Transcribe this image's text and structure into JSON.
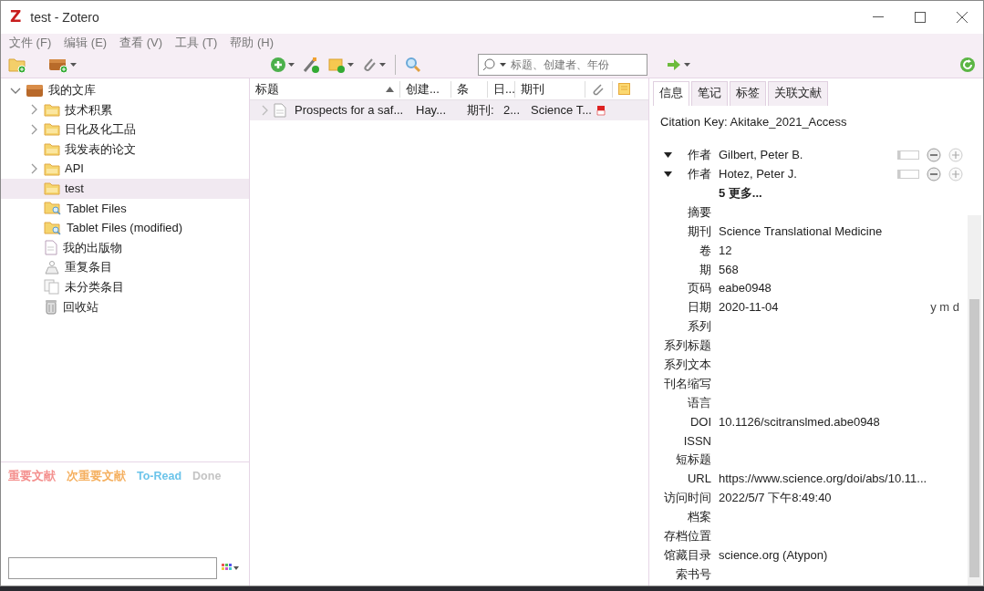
{
  "window": {
    "logo_letter": "Z",
    "title": "test - Zotero"
  },
  "menu": [
    "文件 (F)",
    "编辑 (E)",
    "查看 (V)",
    "工具 (T)",
    "帮助 (H)"
  ],
  "search": {
    "placeholder": "标题、创建者、年份"
  },
  "collections": [
    {
      "label": "我的文库",
      "kind": "library",
      "expanded": true,
      "selected": false,
      "children": [
        {
          "label": "技术积累",
          "kind": "folder",
          "expanded": false,
          "selected": false
        },
        {
          "label": "日化及化工品",
          "kind": "folder",
          "expanded": false,
          "selected": false
        },
        {
          "label": "我发表的论文",
          "kind": "folder",
          "selected": false
        },
        {
          "label": "API",
          "kind": "folder",
          "expanded": false,
          "selected": false
        },
        {
          "label": "test",
          "kind": "folder",
          "selected": true
        },
        {
          "label": "Tablet Files",
          "kind": "saved-search",
          "selected": false
        },
        {
          "label": "Tablet Files (modified)",
          "kind": "saved-search",
          "selected": false
        },
        {
          "label": "我的出版物",
          "kind": "publications",
          "selected": false
        },
        {
          "label": "重复条目",
          "kind": "duplicates",
          "selected": false
        },
        {
          "label": "未分类条目",
          "kind": "unfiled",
          "selected": false
        },
        {
          "label": "回收站",
          "kind": "trash",
          "selected": false
        }
      ]
    }
  ],
  "tags": [
    {
      "label": "重要文献",
      "color": "#f4908e"
    },
    {
      "label": "次重要文献",
      "color": "#f5b060"
    },
    {
      "label": "To-Read",
      "color": "#6cc4ea"
    },
    {
      "label": "Done",
      "color": "#c4c4c4"
    }
  ],
  "table": {
    "columns": [
      {
        "label": "标题",
        "sorted": true
      },
      {
        "label": "创建..."
      },
      {
        "label": "条"
      },
      {
        "label": "日..."
      },
      {
        "label": "期刊"
      }
    ],
    "rows": [
      {
        "selected": true,
        "cells": [
          "Prospects for a saf...",
          "Hay...",
          "期刊:",
          "2...",
          "Science T..."
        ],
        "has_pdf": true
      }
    ]
  },
  "item_pane": {
    "tabs": [
      {
        "label": "信息",
        "selected": true
      },
      {
        "label": "笔记",
        "selected": false
      },
      {
        "label": "标签",
        "selected": false
      },
      {
        "label": "关联文献",
        "selected": false
      }
    ],
    "citation_key": "Citation Key: Akitake_2021_Access",
    "fields": [
      {
        "kind": "creator",
        "label": "作者",
        "value": "Gilbert, Peter B."
      },
      {
        "kind": "creator",
        "label": "作者",
        "value": "Hotez, Peter J."
      },
      {
        "kind": "more",
        "value": "5 更多..."
      },
      {
        "kind": "field",
        "label": "摘要"
      },
      {
        "kind": "field",
        "label": "期刊",
        "value": "Science Translational Medicine"
      },
      {
        "kind": "field",
        "label": "卷",
        "value": "12"
      },
      {
        "kind": "field",
        "label": "期",
        "value": "568"
      },
      {
        "kind": "field",
        "label": "页码",
        "value": "eabe0948"
      },
      {
        "kind": "field",
        "label": "日期",
        "value": "2020-11-04",
        "hint": "y m d"
      },
      {
        "kind": "field",
        "label": "系列"
      },
      {
        "kind": "field",
        "label": "系列标题"
      },
      {
        "kind": "field",
        "label": "系列文本"
      },
      {
        "kind": "field",
        "label": "刊名缩写"
      },
      {
        "kind": "field",
        "label": "语言"
      },
      {
        "kind": "field",
        "label": "DOI",
        "value": "10.1126/scitranslmed.abe0948"
      },
      {
        "kind": "field",
        "label": "ISSN"
      },
      {
        "kind": "field",
        "label": "短标题"
      },
      {
        "kind": "field",
        "label": "URL",
        "value": "https://www.science.org/doi/abs/10.11..."
      },
      {
        "kind": "field",
        "label": "访问时间",
        "value": "2022/5/7 下午8:49:40"
      },
      {
        "kind": "field",
        "label": "档案"
      },
      {
        "kind": "field",
        "label": "存档位置"
      },
      {
        "kind": "field",
        "label": "馆藏目录",
        "value": "science.org (Atypon)"
      },
      {
        "kind": "field",
        "label": "索书号"
      }
    ]
  }
}
